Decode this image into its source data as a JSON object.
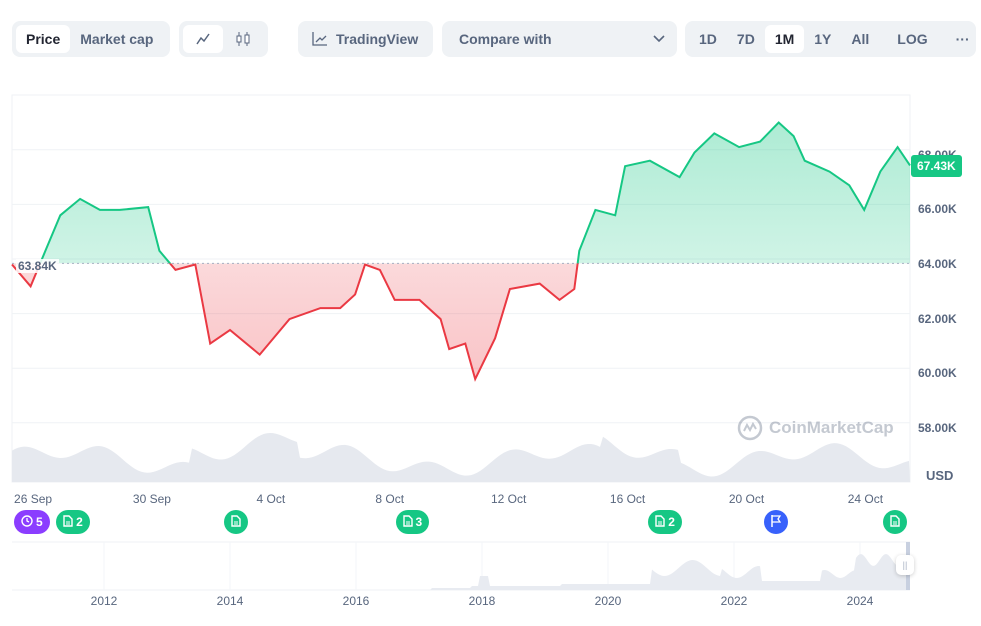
{
  "toolbar": {
    "price": "Price",
    "market_cap": "Market cap",
    "tradingview": "TradingView",
    "compare": "Compare with",
    "ranges": [
      "1D",
      "7D",
      "1M",
      "1Y",
      "All"
    ],
    "selected_range": "1M",
    "log": "LOG",
    "more": "···"
  },
  "chart_data": {
    "type": "area",
    "baseline": 63.84,
    "baseline_label": "63.84K",
    "current_label": "67.43K",
    "ylim": [
      57.5,
      70
    ],
    "y_ticks": [
      {
        "v": 68,
        "l": "68.00K"
      },
      {
        "v": 66,
        "l": "66.00K"
      },
      {
        "v": 64,
        "l": "64.00K"
      },
      {
        "v": 62,
        "l": "62.00K"
      },
      {
        "v": 60,
        "l": "60.00K"
      },
      {
        "v": 58,
        "l": "58.00K"
      }
    ],
    "ylabel": "USD",
    "x_ticks": [
      {
        "d": "2024-09-26T00:00",
        "l": "26 Sep"
      },
      {
        "d": "2024-09-30T00:00",
        "l": "30 Sep"
      },
      {
        "d": "2024-10-04T00:00",
        "l": "4 Oct"
      },
      {
        "d": "2024-10-08T00:00",
        "l": "8 Oct"
      },
      {
        "d": "2024-10-12T00:00",
        "l": "12 Oct"
      },
      {
        "d": "2024-10-16T00:00",
        "l": "16 Oct"
      },
      {
        "d": "2024-10-20T00:00",
        "l": "20 Oct"
      },
      {
        "d": "2024-10-24T00:00",
        "l": "24 Oct"
      }
    ],
    "colors": {
      "up": "#16c784",
      "down": "#ea3943"
    },
    "series": [
      [
        "2024-09-25T07:00",
        63.8
      ],
      [
        "2024-09-25T22:00",
        63.0
      ],
      [
        "2024-09-26T10:00",
        64.3
      ],
      [
        "2024-09-26T22:00",
        65.6
      ],
      [
        "2024-09-27T14:00",
        66.2
      ],
      [
        "2024-09-28T06:00",
        65.8
      ],
      [
        "2024-09-28T22:00",
        65.8
      ],
      [
        "2024-09-29T21:00",
        65.9
      ],
      [
        "2024-09-30T06:00",
        64.3
      ],
      [
        "2024-09-30T19:00",
        63.6
      ],
      [
        "2024-10-01T11:00",
        63.8
      ],
      [
        "2024-10-01T23:00",
        60.9
      ],
      [
        "2024-10-02T15:00",
        61.4
      ],
      [
        "2024-10-03T15:00",
        60.5
      ],
      [
        "2024-10-04T15:00",
        61.8
      ],
      [
        "2024-10-05T16:00",
        62.2
      ],
      [
        "2024-10-06T08:00",
        62.2
      ],
      [
        "2024-10-06T20:00",
        62.7
      ],
      [
        "2024-10-07T04:00",
        63.8
      ],
      [
        "2024-10-07T16:00",
        63.6
      ],
      [
        "2024-10-08T04:00",
        62.5
      ],
      [
        "2024-10-09T00:00",
        62.5
      ],
      [
        "2024-10-09T17:00",
        61.8
      ],
      [
        "2024-10-10T00:00",
        60.7
      ],
      [
        "2024-10-10T13:00",
        60.9
      ],
      [
        "2024-10-10T21:00",
        59.6
      ],
      [
        "2024-10-11T13:00",
        61.1
      ],
      [
        "2024-10-12T01:00",
        62.9
      ],
      [
        "2024-10-13T01:00",
        63.1
      ],
      [
        "2024-10-13T17:00",
        62.5
      ],
      [
        "2024-10-14T05:00",
        62.9
      ],
      [
        "2024-10-14T09:00",
        64.3
      ],
      [
        "2024-10-14T22:00",
        65.8
      ],
      [
        "2024-10-15T14:00",
        65.6
      ],
      [
        "2024-10-15T22:00",
        67.4
      ],
      [
        "2024-10-16T18:00",
        67.6
      ],
      [
        "2024-10-17T18:00",
        67.0
      ],
      [
        "2024-10-18T06:00",
        67.9
      ],
      [
        "2024-10-18T22:00",
        68.6
      ],
      [
        "2024-10-19T18:00",
        68.1
      ],
      [
        "2024-10-20T11:00",
        68.3
      ],
      [
        "2024-10-21T02:00",
        69.0
      ],
      [
        "2024-10-21T14:00",
        68.5
      ],
      [
        "2024-10-21T23:00",
        67.6
      ],
      [
        "2024-10-22T19:00",
        67.2
      ],
      [
        "2024-10-23T11:00",
        66.7
      ],
      [
        "2024-10-23T23:00",
        65.8
      ],
      [
        "2024-10-24T12:00",
        67.2
      ],
      [
        "2024-10-25T02:00",
        68.1
      ],
      [
        "2024-10-25T12:00",
        67.43
      ]
    ]
  },
  "watermark": "CoinMarketCap",
  "events": [
    {
      "type": "history",
      "count": "5",
      "color": "#8b3dff",
      "d": "2024-09-26T00:00"
    },
    {
      "type": "news",
      "count": "2",
      "color": "#16c784",
      "d": "2024-09-27T10:00"
    },
    {
      "type": "news",
      "count": "",
      "color": "#16c784",
      "d": "2024-10-02T20:00"
    },
    {
      "type": "news",
      "count": "3",
      "color": "#16c784",
      "d": "2024-10-08T20:00"
    },
    {
      "type": "news",
      "count": "2",
      "color": "#16c784",
      "d": "2024-10-17T08:00"
    },
    {
      "type": "flag",
      "count": "",
      "color": "#3861fb",
      "d": "2024-10-21T00:00"
    },
    {
      "type": "news",
      "count": "",
      "color": "#16c784",
      "d": "2024-10-25T00:00"
    }
  ],
  "navigator": {
    "years": [
      "2012",
      "2014",
      "2016",
      "2018",
      "2020",
      "2022",
      "2024"
    ]
  }
}
